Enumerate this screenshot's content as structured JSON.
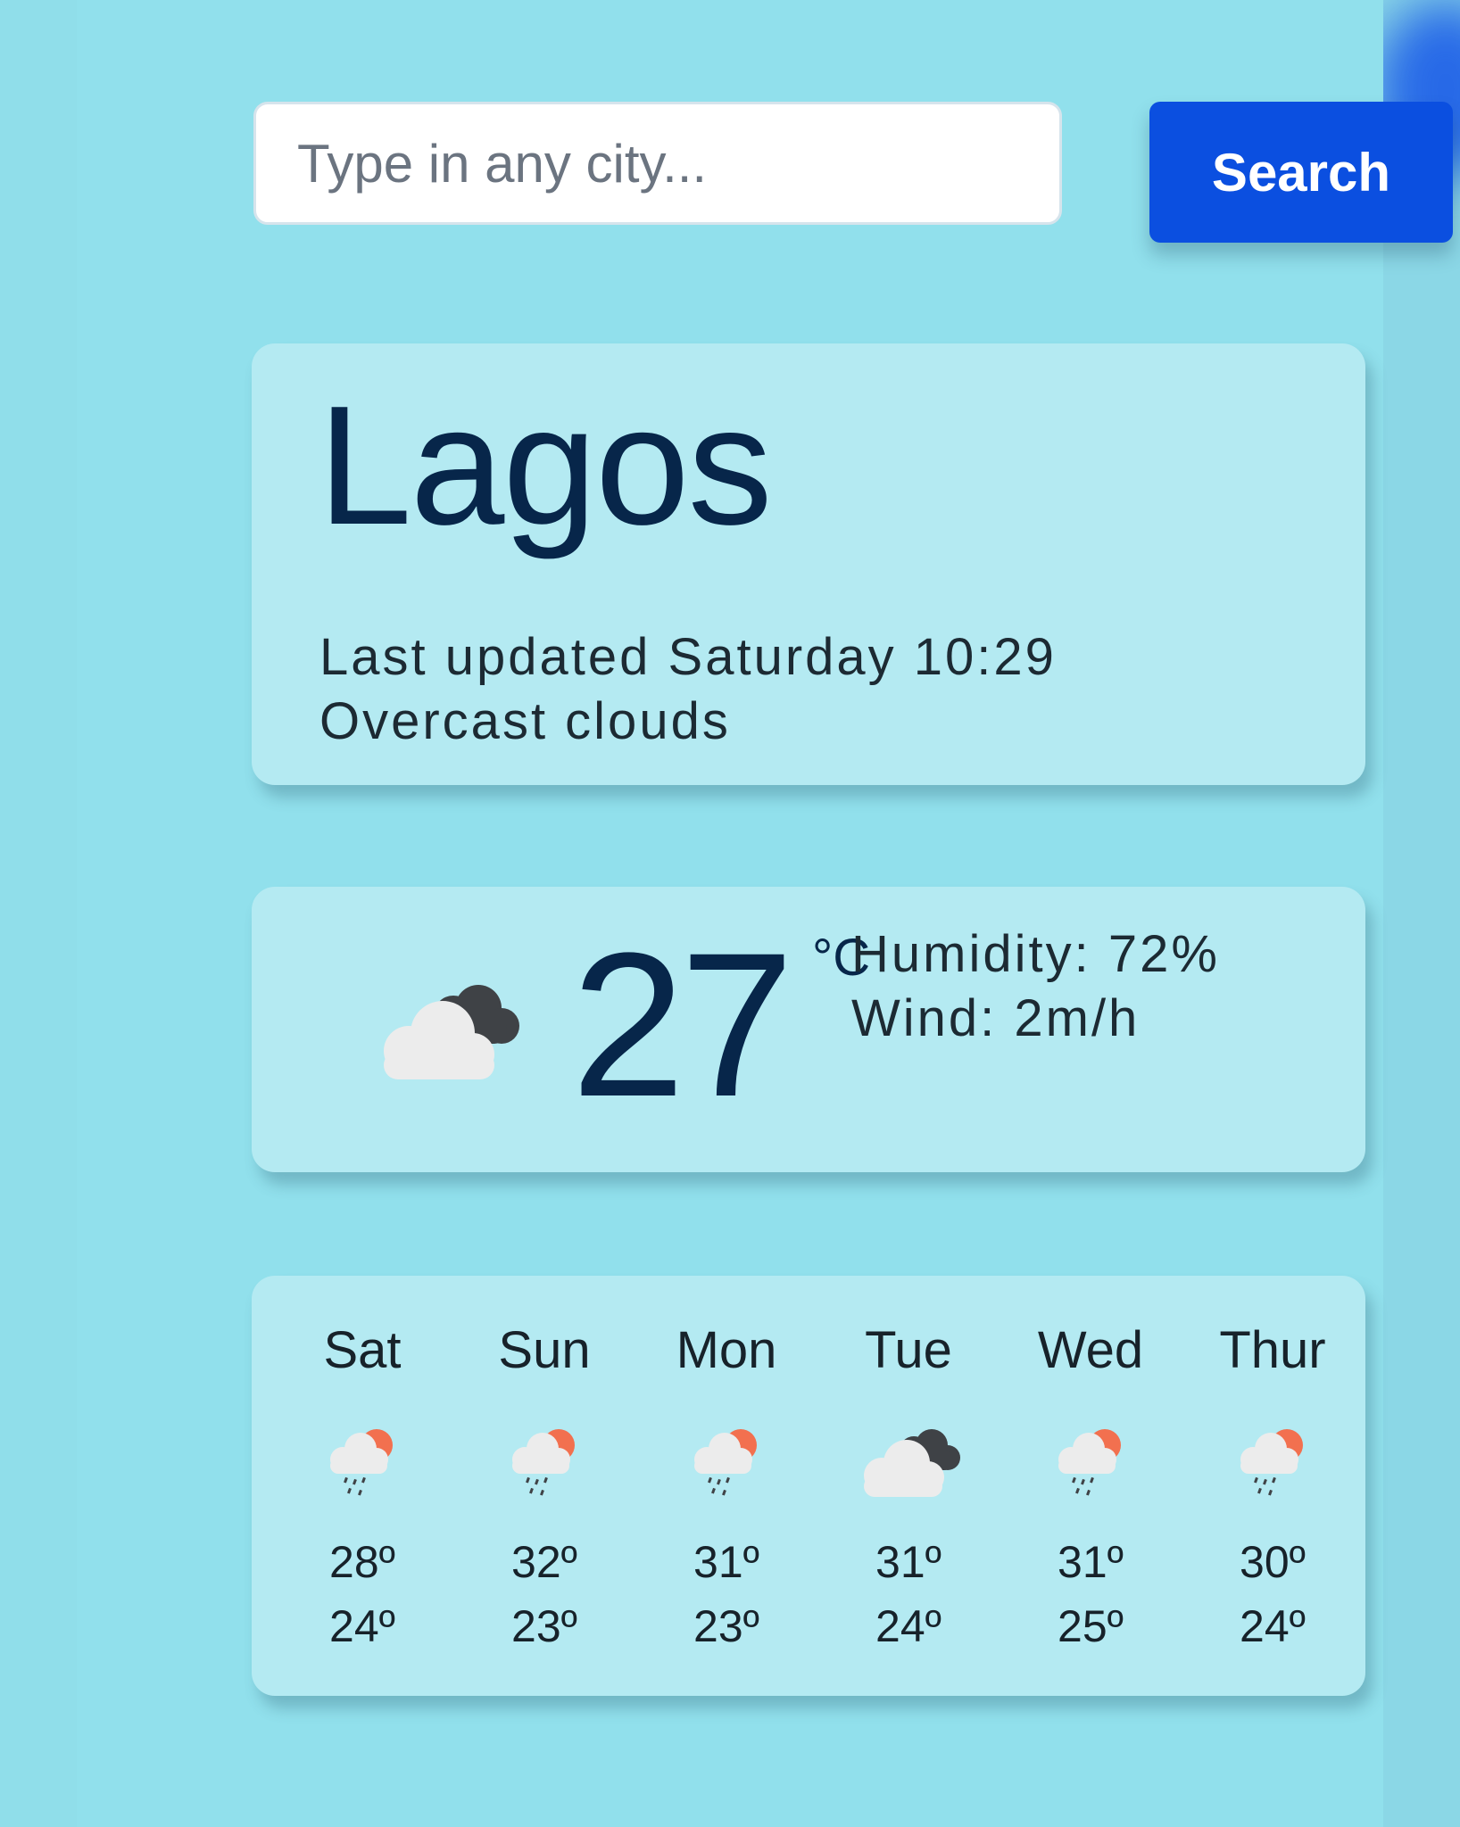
{
  "search": {
    "placeholder": "Type in any city...",
    "value": "",
    "button_label": "Search"
  },
  "city": {
    "name": "Lagos",
    "last_updated": "Last updated Saturday 10:29",
    "condition": "Overcast clouds"
  },
  "current": {
    "icon": "overcast-clouds-icon",
    "temperature": "27",
    "unit": "°C",
    "humidity": "Humidity: 72%",
    "wind": "Wind: 2m/h"
  },
  "forecast": [
    {
      "day": "Sat",
      "icon": "rain-sun-icon",
      "high": "28º",
      "low": "24º"
    },
    {
      "day": "Sun",
      "icon": "rain-sun-icon",
      "high": "32º",
      "low": "23º"
    },
    {
      "day": "Mon",
      "icon": "rain-sun-icon",
      "high": "31º",
      "low": "23º"
    },
    {
      "day": "Tue",
      "icon": "overcast-clouds-icon",
      "high": "31º",
      "low": "24º"
    },
    {
      "day": "Wed",
      "icon": "rain-sun-icon",
      "high": "31º",
      "low": "25º"
    },
    {
      "day": "Thur",
      "icon": "rain-sun-icon",
      "high": "30º",
      "low": "24º"
    }
  ],
  "colors": {
    "background": "#91e0ec",
    "card": "#b4eaf2",
    "button": "#0b4fe0",
    "city_text": "#07264a",
    "sun": "#f2704f"
  }
}
